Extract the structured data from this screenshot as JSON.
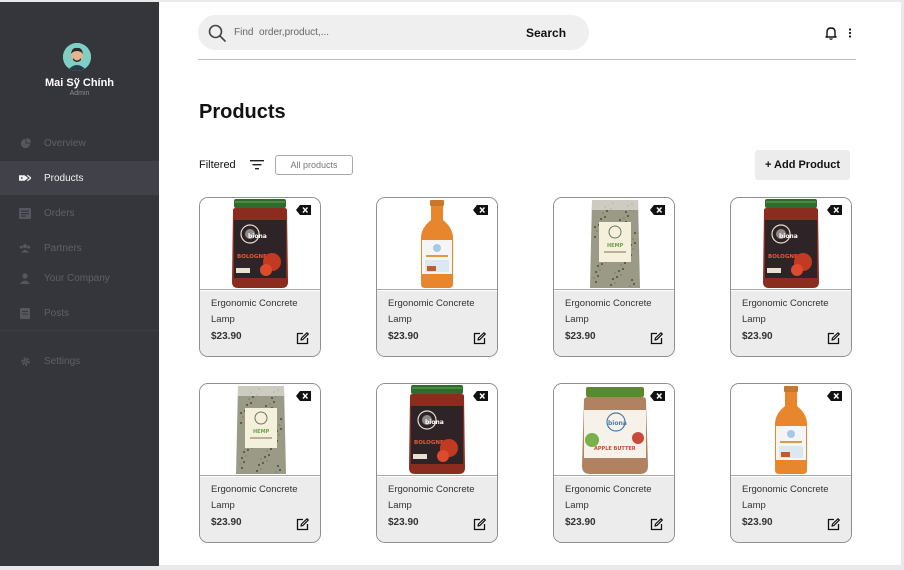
{
  "user": {
    "name": "Mai Sỹ Chính",
    "role": "Admin"
  },
  "nav": [
    {
      "label": "Overview",
      "icon": "pie-chart-icon"
    },
    {
      "label": "Products",
      "icon": "tag-icon"
    },
    {
      "label": "Orders",
      "icon": "list-icon"
    },
    {
      "label": "Partners",
      "icon": "group-icon"
    },
    {
      "label": "Your Company",
      "icon": "person-icon"
    },
    {
      "label": "Posts",
      "icon": "document-icon"
    },
    {
      "label": "Settings",
      "icon": "gear-icon"
    }
  ],
  "search": {
    "placeholder": "Find  order,product,...",
    "button": "Search"
  },
  "page": {
    "title": "Products",
    "filter_label": "Filtered",
    "filter_chip": "All products",
    "add_button": "+ Add Product"
  },
  "products": [
    {
      "name": "Ergonomic Concrete Lamp",
      "price": "$23.90",
      "image": "bolognese-jar",
      "label": "BOLOGNESE"
    },
    {
      "name": "Ergonomic Concrete Lamp",
      "price": "$23.90",
      "image": "juice-bottle",
      "label": ""
    },
    {
      "name": "Ergonomic Concrete Lamp",
      "price": "$23.90",
      "image": "hemp-seed-bag",
      "label": "HEMP"
    },
    {
      "name": "Ergonomic Concrete Lamp",
      "price": "$23.90",
      "image": "bolognese-jar",
      "label": "BOLOGNESE"
    },
    {
      "name": "Ergonomic Concrete Lamp",
      "price": "$23.90",
      "image": "hemp-seed-bag",
      "label": "HEMP"
    },
    {
      "name": "Ergonomic Concrete Lamp",
      "price": "$23.90",
      "image": "bolognese-jar",
      "label": "BOLOGNESE"
    },
    {
      "name": "Ergonomic Concrete Lamp",
      "price": "$23.90",
      "image": "apple-butter-jar",
      "label": "APPLE BUTTER"
    },
    {
      "name": "Ergonomic Concrete Lamp",
      "price": "$23.90",
      "image": "juice-bottle",
      "label": ""
    }
  ],
  "colors": {
    "sidebar": "#35363c",
    "sidebar_active": "#414249",
    "card_info": "#ececec",
    "accent_jar": "#3a2a2a"
  }
}
